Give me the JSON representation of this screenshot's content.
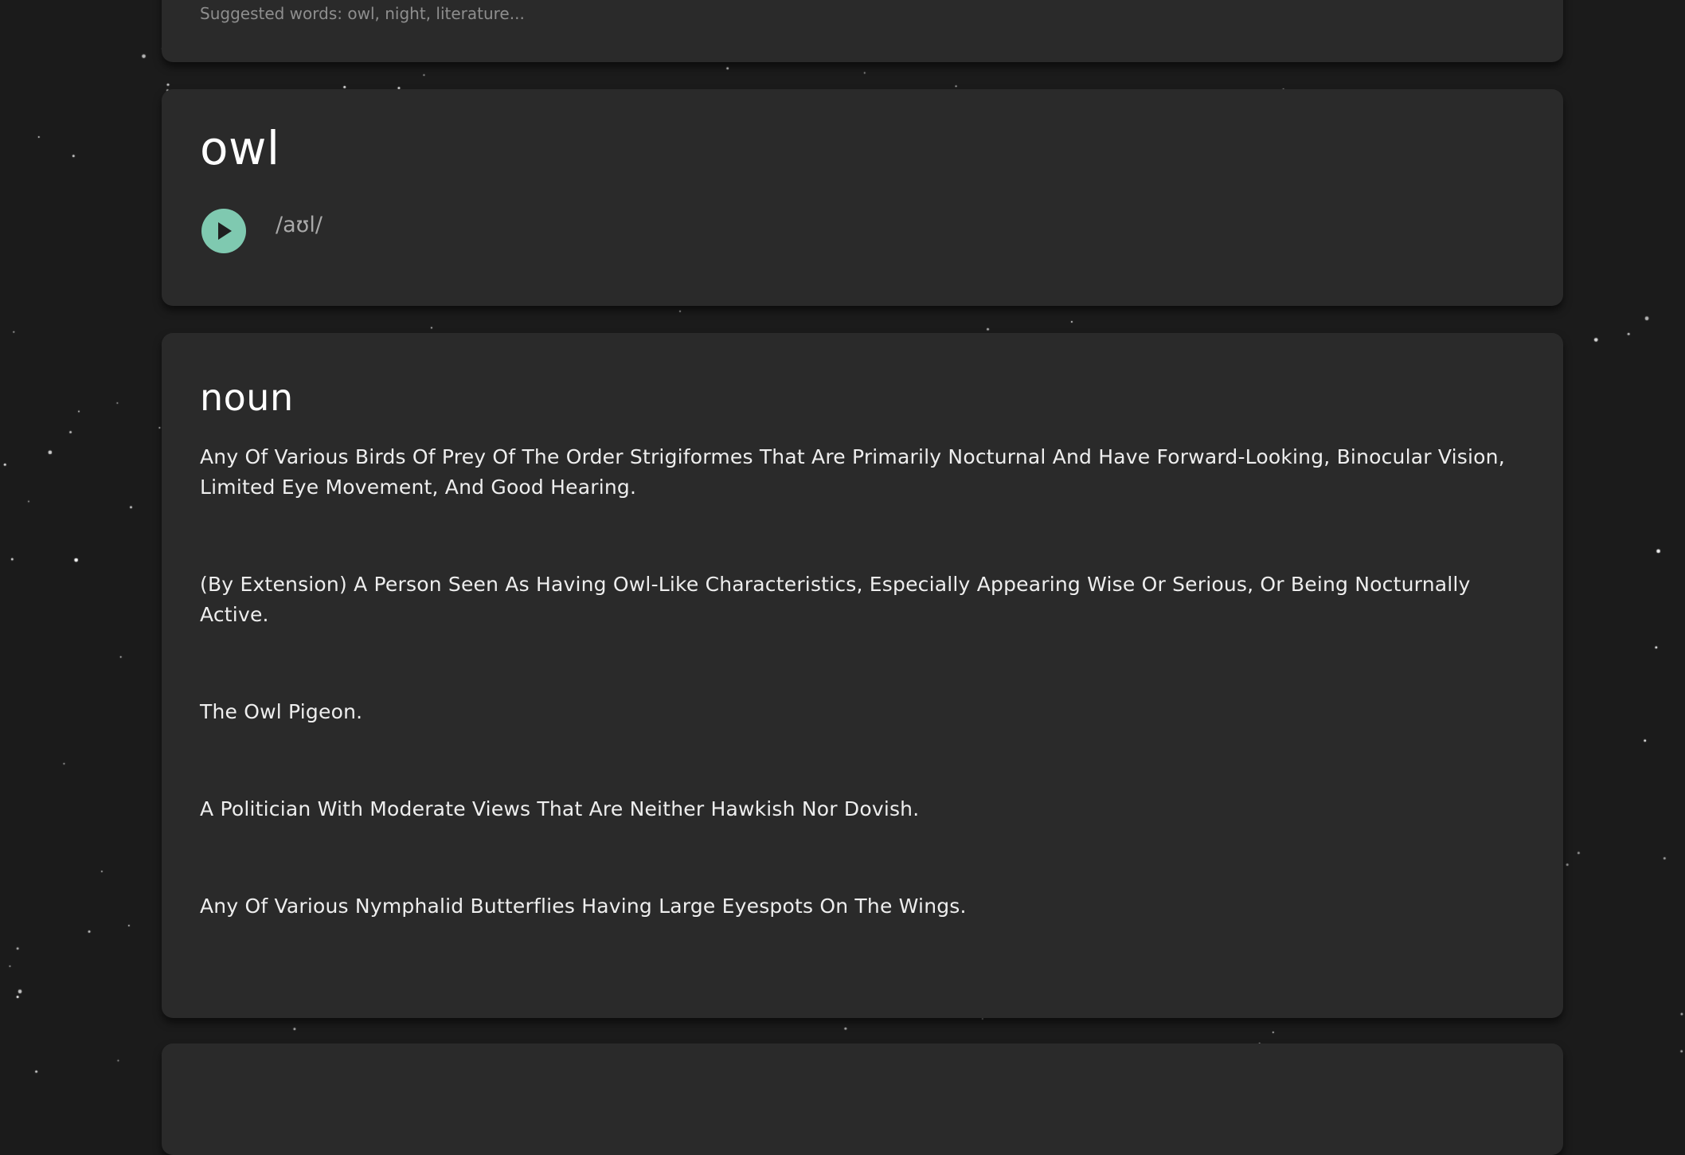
{
  "search": {
    "hint": "Suggested words: owl, night, literature..."
  },
  "word": {
    "text": "owl",
    "phonetic": "/aʊl/",
    "play_icon": "play-icon"
  },
  "meanings": [
    {
      "part_of_speech": "noun",
      "definitions": [
        "Any Of Various Birds Of Prey Of The Order Strigiformes That Are Primarily Nocturnal And Have Forward-Looking, Binocular Vision, Limited Eye Movement, And Good Hearing.",
        "(By Extension) A Person Seen As Having Owl-Like Characteristics, Especially Appearing Wise Or Serious, Or Being Nocturnally Active.",
        "The Owl Pigeon.",
        "A Politician With Moderate Views That Are Neither Hawkish Nor Dovish.",
        "Any Of Various Nymphalid Butterflies Having Large Eyespots On The Wings."
      ]
    }
  ],
  "colors": {
    "background": "#1b1b1b",
    "card": "#2a2a2a",
    "accent": "#7fc9b0",
    "text": "#eeeeee",
    "muted": "#8e8e8e"
  }
}
